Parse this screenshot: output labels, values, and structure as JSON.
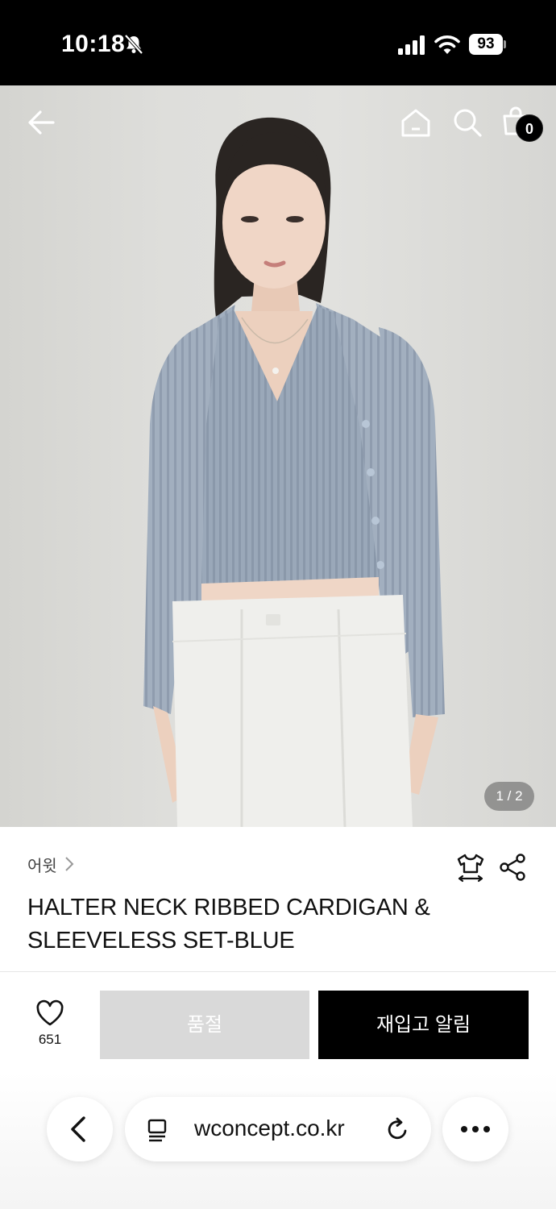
{
  "status_bar": {
    "time": "10:18",
    "battery": "93"
  },
  "header": {
    "cart_count": "0"
  },
  "gallery": {
    "counter": "1 / 2"
  },
  "product": {
    "brand": "어윗",
    "title": "HALTER NECK RIBBED CARDIGAN & SLEEVELESS SET-BLUE"
  },
  "actions": {
    "likes": "651",
    "soldout_label": "품절",
    "restock_label": "재입고 알림"
  },
  "browser": {
    "url": "wconcept.co.kr"
  },
  "colors": {
    "knit_blue": "#98a6b7",
    "pants_white": "#efefec",
    "accent": "#000000"
  }
}
